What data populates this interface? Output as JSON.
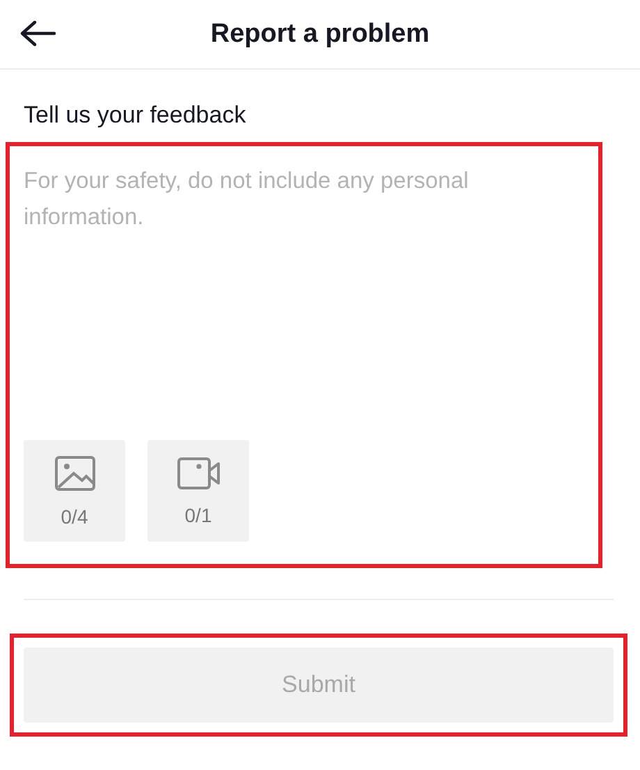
{
  "header": {
    "title": "Report a problem"
  },
  "feedback": {
    "label": "Tell us your feedback",
    "placeholder": "For your safety, do not include any personal information."
  },
  "attachments": [
    {
      "kind": "image",
      "count": "0/4"
    },
    {
      "kind": "video",
      "count": "0/1"
    }
  ],
  "submit": {
    "label": "Submit",
    "disabled": true
  }
}
